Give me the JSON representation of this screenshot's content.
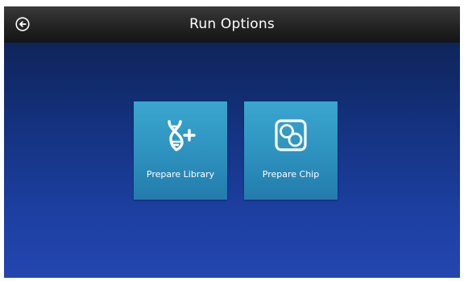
{
  "header": {
    "title": "Run Options",
    "back_icon": "arrow-left-circle-icon"
  },
  "tiles": [
    {
      "label": "Prepare Library",
      "icon": "dna-plus-icon"
    },
    {
      "label": "Prepare Chip",
      "icon": "chip-two-circles-icon"
    }
  ],
  "colors": {
    "title_bar": "#232323",
    "background_top": "#0c1f4a",
    "background_bottom": "#2346b0",
    "tile": "#2e93bf",
    "text": "#ffffff"
  }
}
